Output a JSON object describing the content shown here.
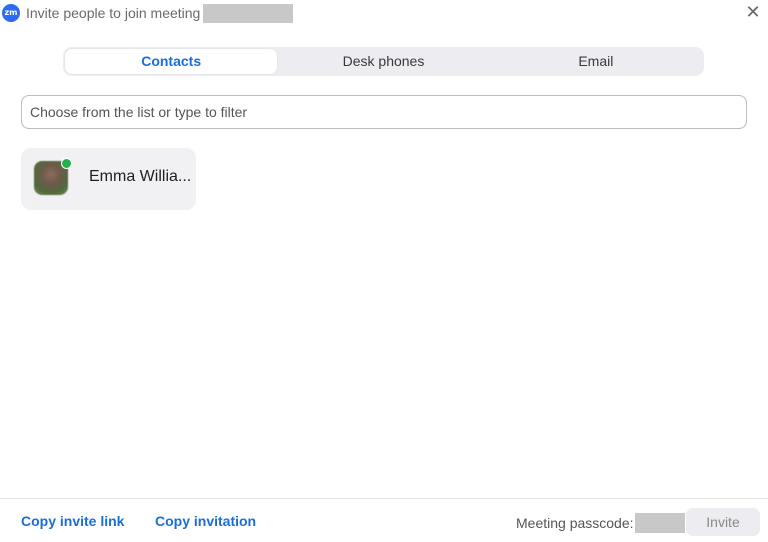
{
  "window": {
    "logo_text": "zm",
    "title": "Invite people to join meeting",
    "close_symbol": "✕"
  },
  "tabs": [
    {
      "label": "Contacts",
      "active": true
    },
    {
      "label": "Desk phones",
      "active": false
    },
    {
      "label": "Email",
      "active": false
    }
  ],
  "filter": {
    "placeholder": "Choose from the list or type to filter",
    "value": ""
  },
  "contacts": [
    {
      "name": "Emma Willia...",
      "status": "online",
      "status_color": "#22b14c"
    }
  ],
  "footer": {
    "copy_invite_link": "Copy invite link",
    "copy_invitation": "Copy invitation",
    "passcode_label": "Meeting passcode:",
    "invite_button": "Invite"
  },
  "colors": {
    "accent": "#1a6ed8",
    "logo": "#2d6cf0"
  }
}
